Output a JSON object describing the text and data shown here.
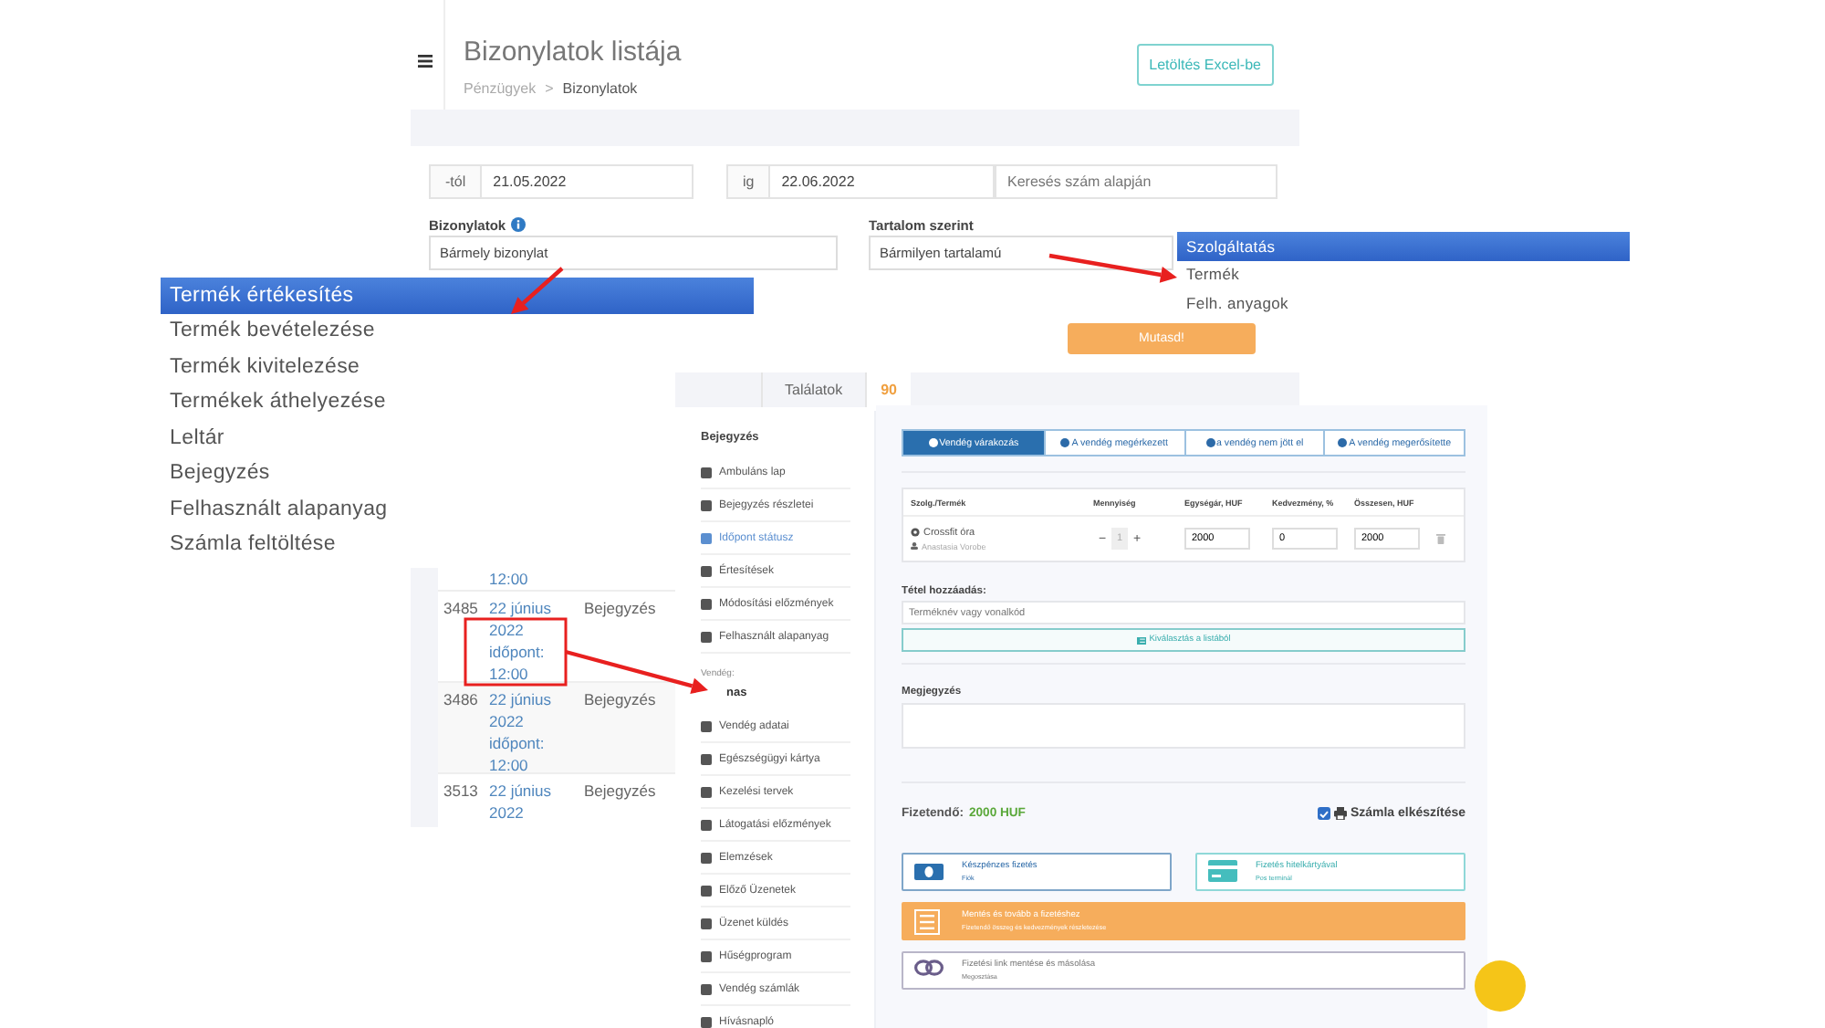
{
  "list_page": {
    "title": "Bizonylatok listája",
    "breadcrumb": [
      "Pénzügyek",
      "Bizonylatok"
    ],
    "breadcrumb_separator": ">",
    "export_button": "Letöltés Excel-be",
    "date_from": {
      "label": "-tól",
      "value": "21.05.2022"
    },
    "date_to": {
      "label": "ig",
      "value": "22.06.2022"
    },
    "search": {
      "placeholder": "Keresés szám alapján"
    },
    "documents": {
      "label": "Bizonylatok",
      "value": "Bármely bizonylat"
    },
    "content": {
      "label": "Tartalom szerint",
      "value": "Bármilyen tartalamú"
    },
    "show_button": "Mutasd!",
    "results": {
      "label": "Találatok",
      "count": "90"
    }
  },
  "documents_dropdown": [
    {
      "label": "Termék értékesítés",
      "selected": true
    },
    {
      "label": "Termék bevételezése",
      "selected": false
    },
    {
      "label": "Termék kivitelezése",
      "selected": false
    },
    {
      "label": "Termékek áthelyezése",
      "selected": false
    },
    {
      "label": "Leltár",
      "selected": false
    },
    {
      "label": "Bejegyzés",
      "selected": false
    },
    {
      "label": "Felhasznált alapanyag",
      "selected": false
    },
    {
      "label": "Számla feltöltése",
      "selected": false
    }
  ],
  "content_dropdown": [
    {
      "label": "Szolgáltatás",
      "selected": true
    },
    {
      "label": "Termék",
      "selected": false
    },
    {
      "label": "Felh. anyagok",
      "selected": false
    }
  ],
  "table_rows": [
    {
      "column_2": "12:00"
    },
    {
      "column_1": "3485",
      "column_2": "22 június 2022 időpont: 12:00",
      "column_3": "Bejegyzés"
    },
    {
      "column_1": "3486",
      "column_2": "22 június 2022 időpont: 12:00",
      "column_3": "Bejegyzés"
    },
    {
      "column_1": "3513",
      "column_2": "22 június 2022",
      "column_3": "Bejegyzés"
    }
  ],
  "sidebar": {
    "heading": "Bejegyzés",
    "items": [
      {
        "label": "Ambuláns lap",
        "selected": false
      },
      {
        "label": "Bejegyzés részletei",
        "selected": false
      },
      {
        "label": "Időpont státusz",
        "selected": true
      },
      {
        "label": "Értesítések",
        "selected": false
      },
      {
        "label": "Módosítási előzmények",
        "selected": false
      },
      {
        "label": "Felhasznált alapanyag",
        "selected": false
      }
    ],
    "guest_label": "Vendég:",
    "guest_name": "nas",
    "guest_items": [
      {
        "label": "Vendég adatai",
        "selected": false
      },
      {
        "label": "Egészségügyi kártya",
        "selected": false
      },
      {
        "label": "Kezelési tervek",
        "selected": false
      },
      {
        "label": "Látogatási előzmények",
        "selected": false
      },
      {
        "label": "Elemzések",
        "selected": false
      },
      {
        "label": "Előző Üzenetek",
        "selected": false
      },
      {
        "label": "Üzenet küldés",
        "selected": false
      },
      {
        "label": "Hűségprogram",
        "selected": false
      },
      {
        "label": "Vendég számlák",
        "selected": false
      },
      {
        "label": "Hívásnapló",
        "selected": false
      }
    ]
  },
  "form": {
    "status_tabs": [
      {
        "label": "Vendég várakozás",
        "selected": true
      },
      {
        "label": "A vendég megérkezett",
        "selected": false
      },
      {
        "label": "a vendég nem jött el",
        "selected": false
      },
      {
        "label": "A vendég megerősítette",
        "selected": false
      }
    ],
    "columns": [
      "Szolg./Termék",
      "Mennyiség",
      "Egységár, HUF",
      "Kedvezmény, %",
      "Összesen, HUF"
    ],
    "item": {
      "name": "Crossfit óra",
      "staff": "Anastasia Vorobe",
      "decrement": "−",
      "quantity": "1",
      "increment": "+",
      "unit_price": "2000",
      "discount": "0",
      "total": "2000"
    },
    "add_label": "Tétel hozzáadás:",
    "add_placeholder": "Terméknév vagy vonalkód",
    "pick_button": "Kiválasztás a listából",
    "note_label": "Megjegyzés",
    "payable_label": "Fizetendő:",
    "payable_amount": "2000 HUF",
    "invoice": {
      "label": "Számla elkészítése",
      "checked": true
    },
    "payment_options": [
      {
        "kind": "cash",
        "title": "Készpénzes fizetés",
        "subtitle": "Fiók"
      },
      {
        "kind": "card",
        "title": "Fizetés hitelkártyával",
        "subtitle": "Pos terminál"
      },
      {
        "kind": "save",
        "title": "Mentés és tovább a fizetéshez",
        "subtitle": "Fizetendő összeg és kedvezmények részletezése"
      },
      {
        "kind": "link",
        "title": "Fizetési link mentése és másolása",
        "subtitle": "Megosztása"
      }
    ]
  }
}
